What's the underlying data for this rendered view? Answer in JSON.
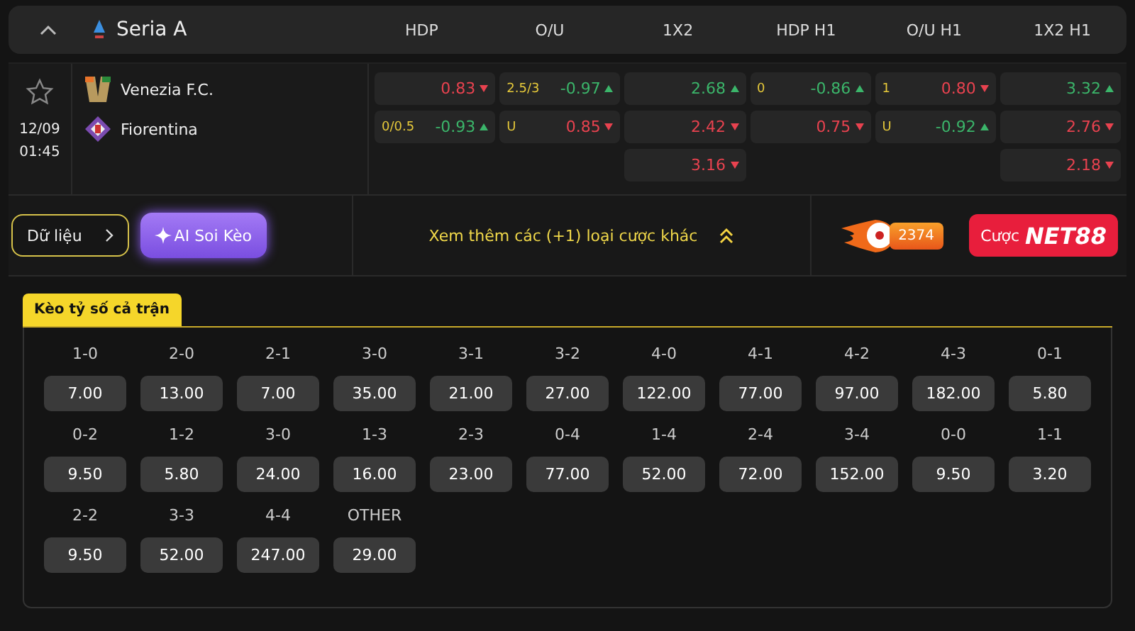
{
  "league": {
    "name": "Seria A",
    "expanded": true
  },
  "columns": [
    "HDP",
    "O/U",
    "1X2",
    "HDP H1",
    "O/U H1",
    "1X2 H1"
  ],
  "match": {
    "favorite": false,
    "date": "12/09",
    "time": "01:45",
    "home": "Venezia F.C.",
    "away": "Fiorentina",
    "odds": [
      [
        {
          "value": "0.83",
          "rising": false
        },
        {
          "line": "0/0.5",
          "value": "-0.93",
          "rising": true
        }
      ],
      [
        {
          "line": "2.5/3",
          "value": "-0.97",
          "rising": true
        },
        {
          "line": "U",
          "value": "0.85",
          "rising": false
        }
      ],
      [
        {
          "value": "2.68",
          "rising": true
        },
        {
          "value": "2.42",
          "rising": false
        },
        {
          "value": "3.16",
          "rising": false
        }
      ],
      [
        {
          "line": "0",
          "value": "-0.86",
          "rising": true
        },
        {
          "value": "0.75",
          "rising": false
        }
      ],
      [
        {
          "line": "1",
          "value": "0.80",
          "rising": false
        },
        {
          "line": "U",
          "value": "-0.92",
          "rising": true
        }
      ],
      [
        {
          "value": "3.32",
          "rising": true
        },
        {
          "value": "2.76",
          "rising": false
        },
        {
          "value": "2.18",
          "rising": false
        }
      ]
    ]
  },
  "actions": {
    "data_button": "Dữ liệu",
    "ai_button": "AI Soi Kèo",
    "more": "Xem thêm các (+1) loại cược khác",
    "hot_count": "2374",
    "bet_button": "Cược",
    "bet_brand": "NET88"
  },
  "score_tab": {
    "label": "Kèo tỷ số cả trận",
    "selected": true
  },
  "scores": [
    {
      "score": "1-0",
      "odds": "7.00"
    },
    {
      "score": "2-0",
      "odds": "13.00"
    },
    {
      "score": "2-1",
      "odds": "7.00"
    },
    {
      "score": "3-0",
      "odds": "35.00"
    },
    {
      "score": "3-1",
      "odds": "21.00"
    },
    {
      "score": "3-2",
      "odds": "27.00"
    },
    {
      "score": "4-0",
      "odds": "122.00"
    },
    {
      "score": "4-1",
      "odds": "77.00"
    },
    {
      "score": "4-2",
      "odds": "97.00"
    },
    {
      "score": "4-3",
      "odds": "182.00"
    },
    {
      "score": "0-1",
      "odds": "5.80"
    },
    {
      "score": "0-2",
      "odds": "9.50"
    },
    {
      "score": "1-2",
      "odds": "5.80"
    },
    {
      "score": "3-0",
      "odds": "24.00"
    },
    {
      "score": "1-3",
      "odds": "16.00"
    },
    {
      "score": "2-3",
      "odds": "23.00"
    },
    {
      "score": "0-4",
      "odds": "77.00"
    },
    {
      "score": "1-4",
      "odds": "52.00"
    },
    {
      "score": "2-4",
      "odds": "72.00"
    },
    {
      "score": "3-4",
      "odds": "152.00"
    },
    {
      "score": "0-0",
      "odds": "9.50"
    },
    {
      "score": "1-1",
      "odds": "3.20"
    },
    {
      "score": "2-2",
      "odds": "9.50"
    },
    {
      "score": "3-3",
      "odds": "52.00"
    },
    {
      "score": "4-4",
      "odds": "247.00"
    },
    {
      "score": "OTHER",
      "odds": "29.00"
    }
  ]
}
